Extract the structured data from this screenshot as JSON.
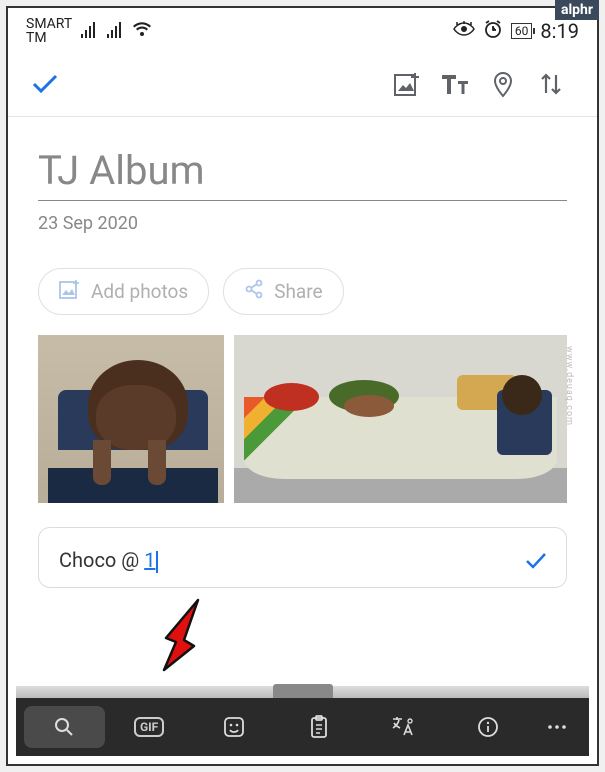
{
  "status": {
    "carrier_line1": "SMART",
    "carrier_line2": "TM",
    "battery": "60",
    "time": "8:19"
  },
  "album": {
    "title": "TJ Album",
    "date": "23 Sep 2020"
  },
  "actions": {
    "add_photos": "Add photos",
    "share": "Share"
  },
  "caption": {
    "text_before": "Choco @ ",
    "link_text": "1"
  },
  "watermark": {
    "badge": "alphr",
    "side": "www.deuaq.com"
  }
}
